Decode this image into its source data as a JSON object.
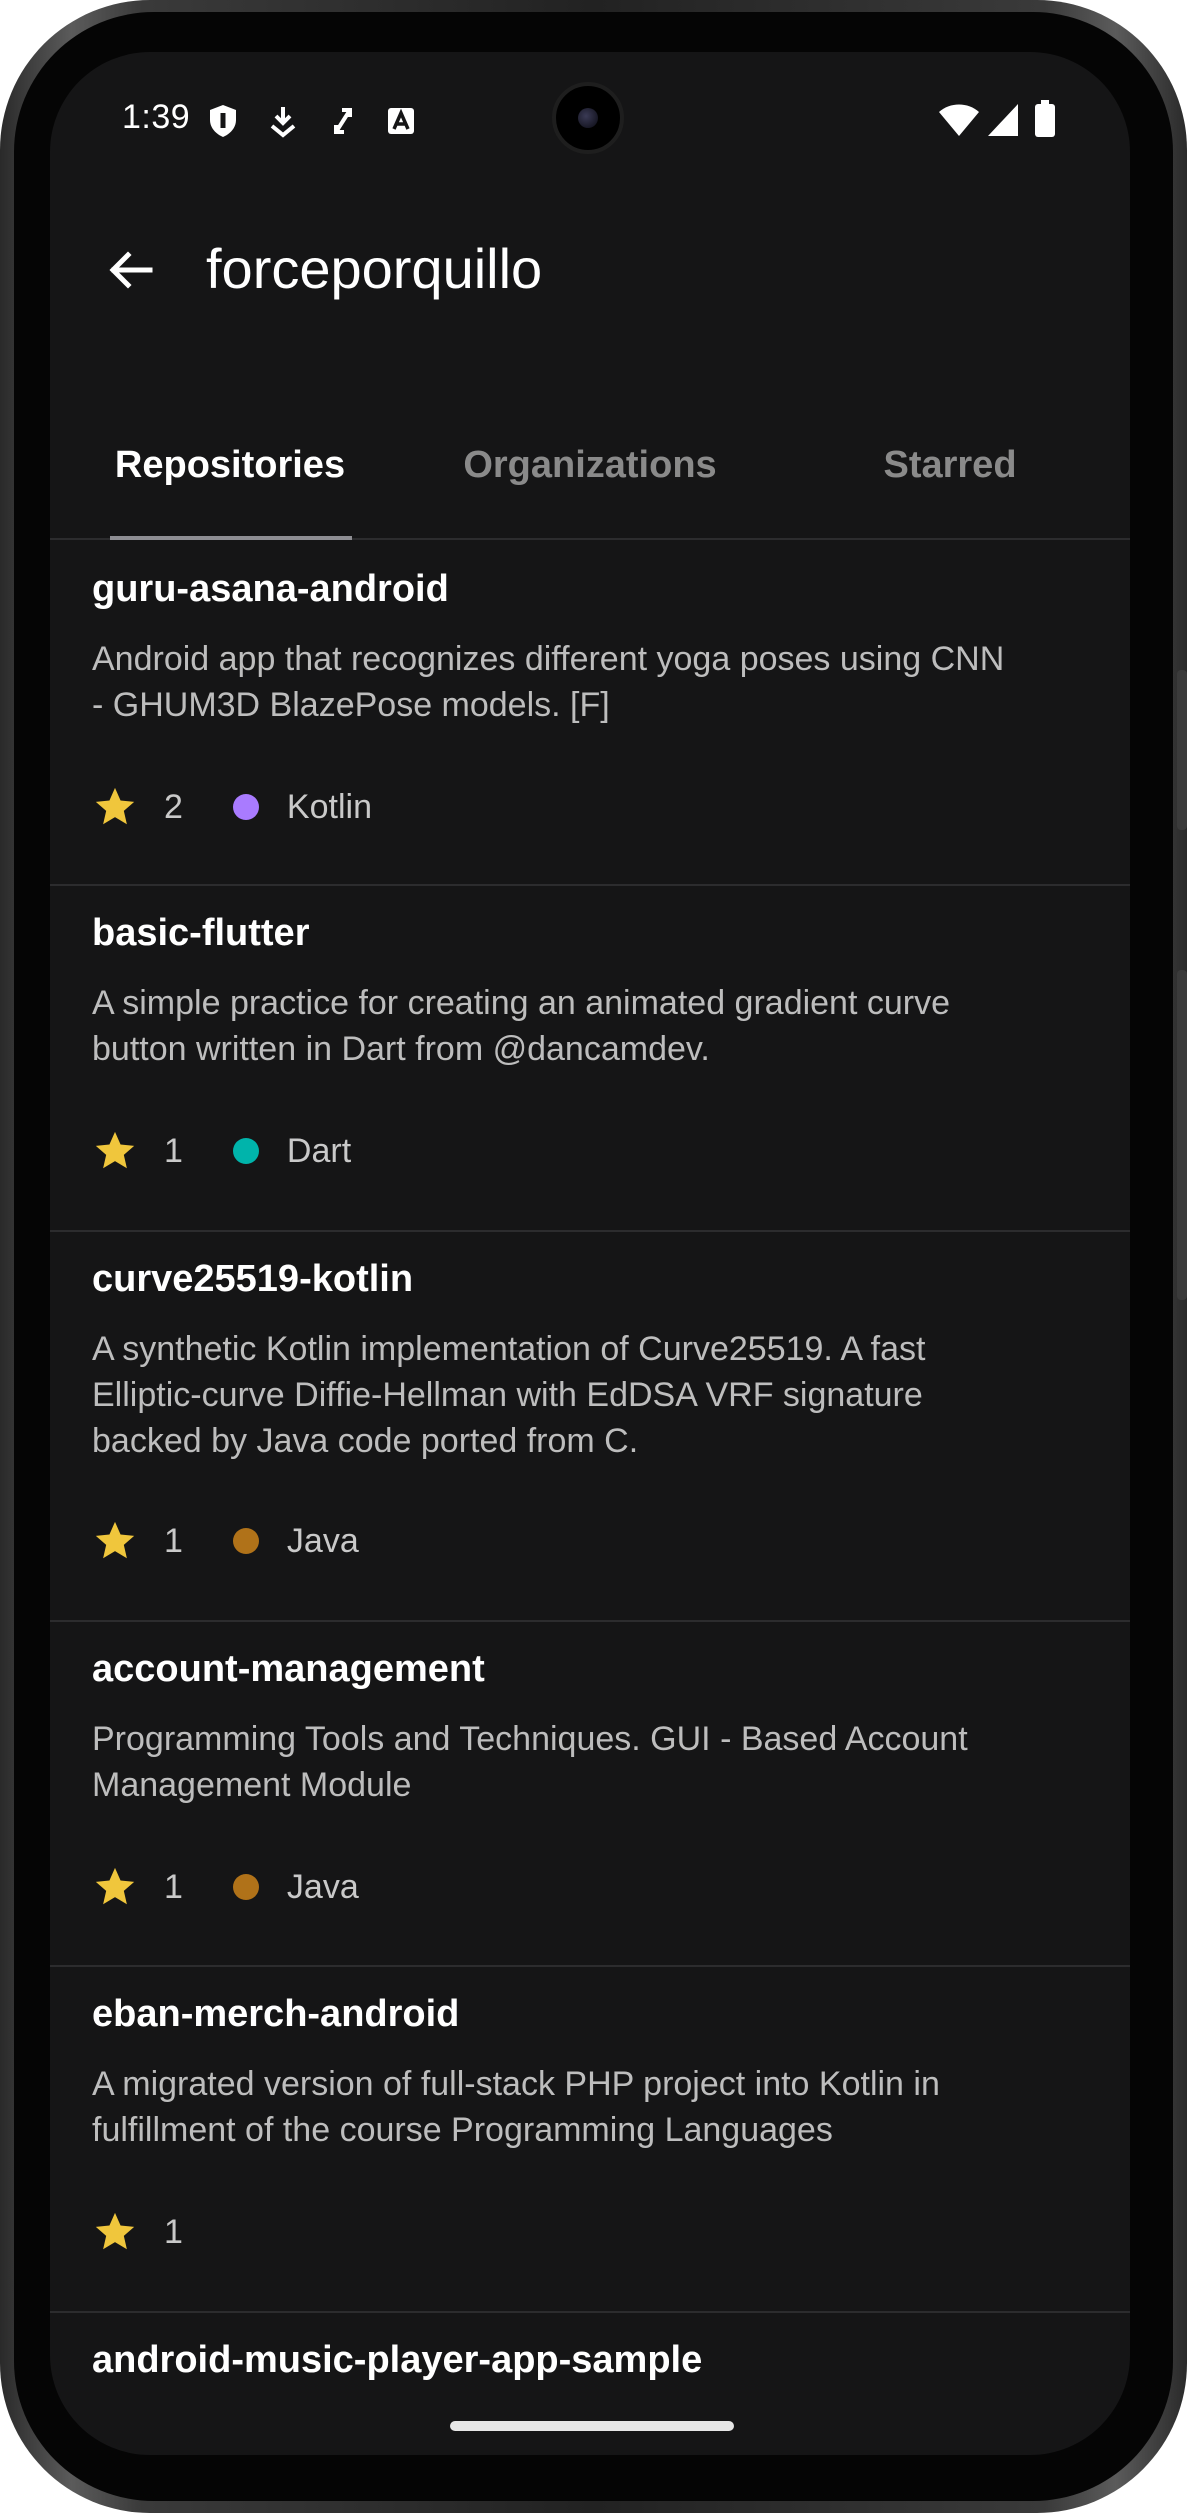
{
  "status_bar": {
    "time": "1:39",
    "left_icons": [
      "shield-icon",
      "download-icon",
      "sync-icon",
      "text-icon"
    ],
    "right_icons": [
      "wifi-icon",
      "cellular-icon",
      "battery-icon"
    ]
  },
  "app_bar": {
    "title": "forceporquillo",
    "back_icon": "arrow-back-icon"
  },
  "tabs": [
    {
      "label": "Repositories",
      "active": true
    },
    {
      "label": "Organizations",
      "active": false
    },
    {
      "label": "Starred",
      "active": false
    }
  ],
  "repos": [
    {
      "name": "guru-asana-android",
      "description": [
        "Android app that recognizes different yoga poses using CNN",
        "- GHUM3D BlazePose models. [F]"
      ],
      "stars": "2",
      "language": "Kotlin",
      "language_color": "#a97bff"
    },
    {
      "name": "basic-flutter",
      "description": [
        "A simple practice for creating an animated gradient curve",
        "button written in Dart from @dancamdev."
      ],
      "stars": "1",
      "language": "Dart",
      "language_color": "#00b4ab"
    },
    {
      "name": "curve25519-kotlin",
      "description": [
        "A synthetic Kotlin implementation of Curve25519. A fast",
        "Elliptic-curve Diffie-Hellman with EdDSA VRF signature",
        "backed by Java code ported from C."
      ],
      "stars": "1",
      "language": "Java",
      "language_color": "#b07219"
    },
    {
      "name": "account-management",
      "description": [
        "Programming Tools and Techniques. GUI - Based Account",
        "Management Module"
      ],
      "stars": "1",
      "language": "Java",
      "language_color": "#b07219"
    },
    {
      "name": "eban-merch-android",
      "description": [
        "A migrated version of full-stack PHP project into Kotlin in",
        "fulfillment of the course Programming Languages"
      ],
      "stars": "1",
      "language": "",
      "language_color": ""
    },
    {
      "name": "android-music-player-app-sample",
      "description": [],
      "stars": "",
      "language": "",
      "language_color": ""
    }
  ],
  "colors": {
    "background": "#151516",
    "star": "#f0c63c",
    "divider": "#2c2c2e"
  }
}
